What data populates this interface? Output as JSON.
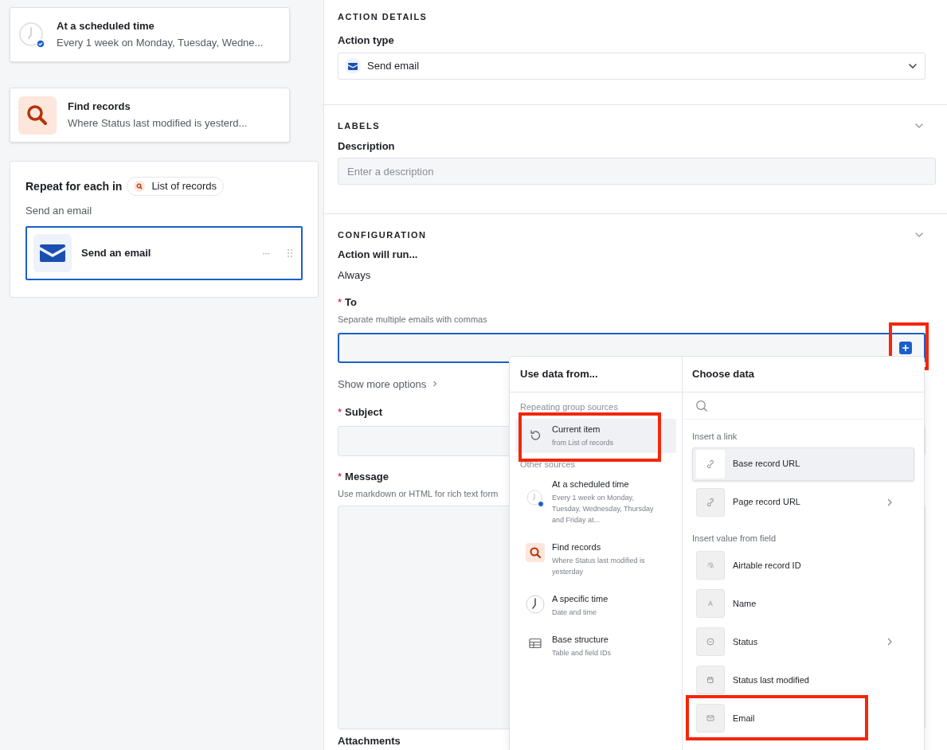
{
  "flow": {
    "steps": [
      {
        "kind": "schedule",
        "title": "At a scheduled time",
        "subtitle": "Every 1 week on Monday, Tuesday, Wedne..."
      },
      {
        "kind": "find",
        "title": "Find records",
        "subtitle": "Where Status last modified is yesterd..."
      }
    ],
    "repeat": {
      "title": "Repeat for each in",
      "source": "List of records",
      "subtitle": "Send an email",
      "action": {
        "title": "Send an email",
        "selected": true,
        "more": "···"
      }
    }
  },
  "details": {
    "action_details": {
      "heading": "ACTION DETAILS",
      "label": "Action type",
      "value": "Send email"
    },
    "labels": {
      "heading": "LABELS",
      "expanded": true,
      "label": "Description",
      "placeholder": "Enter a description"
    },
    "configuration": {
      "heading": "CONFIGURATION",
      "expanded": true,
      "run_label": "Action will run...",
      "run_value": "Always",
      "to": {
        "label": "To",
        "required_mark": "*",
        "hint": "Separate multiple emails with commas",
        "focused": true,
        "add_highlighted": true
      },
      "more_options": "Show more options",
      "subject": {
        "label": "Subject",
        "required_mark": "*"
      },
      "message": {
        "label": "Message",
        "required_mark": "*",
        "hint": "Use markdown or HTML for rich text form"
      },
      "attachments": {
        "label": "Attachments"
      }
    }
  },
  "popover": {
    "sources_title": "Use data from...",
    "source_groups": [
      {
        "label": "Repeating group sources",
        "items": [
          {
            "kind": "repeat",
            "title": "Current item",
            "description": "from List of records",
            "selected": true,
            "highlighted": true
          }
        ]
      },
      {
        "label": "Other sources",
        "items": [
          {
            "kind": "schedule",
            "title": "At a scheduled time",
            "description": "Every 1 week on Monday, Tuesday, Wednesday, Thursday and Friday at...",
            "selected": false,
            "highlighted": false
          },
          {
            "kind": "find",
            "title": "Find records",
            "description": "Where Status last modified is yesterday",
            "selected": false,
            "highlighted": false
          },
          {
            "kind": "time",
            "title": "A specific time",
            "description": "Date and time",
            "selected": false,
            "highlighted": false
          },
          {
            "kind": "table",
            "title": "Base structure",
            "description": "Table and field IDs",
            "selected": false,
            "highlighted": false
          }
        ]
      }
    ],
    "data_title": "Choose data",
    "data_groups": [
      {
        "label": "Insert a link",
        "items": [
          {
            "kind": "link",
            "label": "Base record URL",
            "selected": true,
            "expandable": false,
            "highlighted": false
          },
          {
            "kind": "link",
            "label": "Page record URL",
            "selected": false,
            "expandable": true,
            "highlighted": false
          }
        ]
      },
      {
        "label": "Insert value from field",
        "items": [
          {
            "kind": "id",
            "label": "Airtable record ID",
            "selected": false,
            "expandable": false,
            "highlighted": false
          },
          {
            "kind": "text",
            "label": "Name",
            "selected": false,
            "expandable": false,
            "highlighted": false
          },
          {
            "kind": "select",
            "label": "Status",
            "selected": false,
            "expandable": true,
            "highlighted": false
          },
          {
            "kind": "date",
            "label": "Status last modified",
            "selected": false,
            "expandable": false,
            "highlighted": false
          },
          {
            "kind": "email",
            "label": "Email",
            "selected": false,
            "expandable": false,
            "highlighted": true
          }
        ]
      }
    ]
  }
}
